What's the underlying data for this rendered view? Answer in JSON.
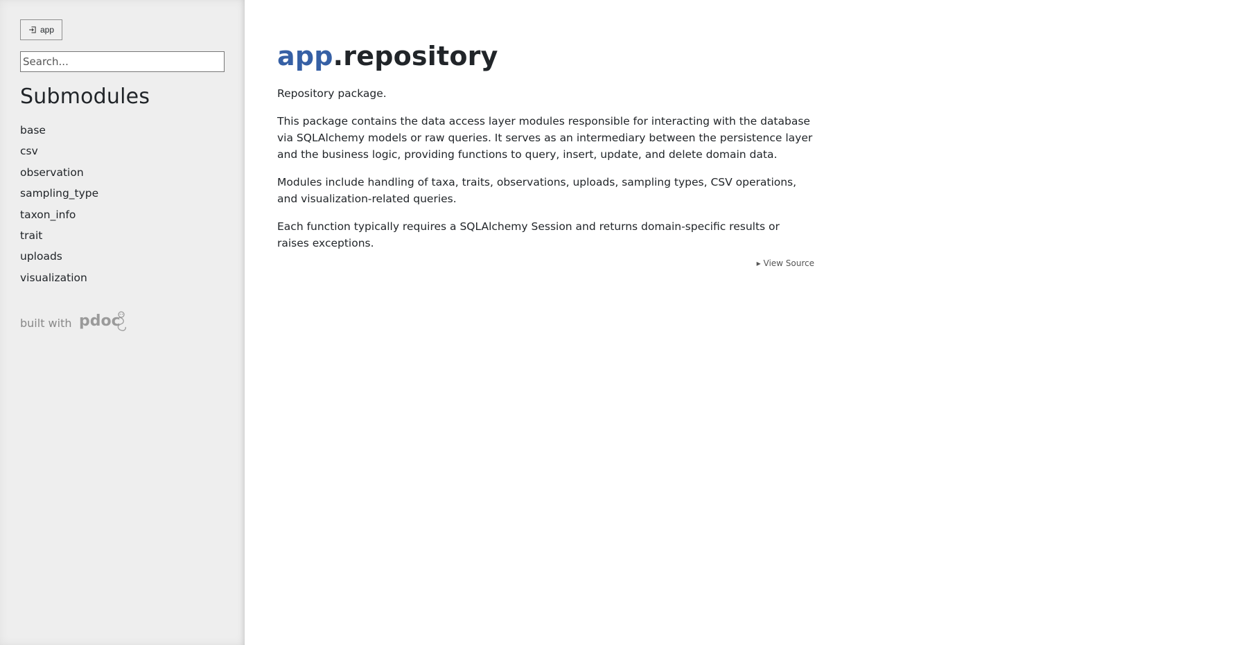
{
  "sidebar": {
    "home_button_label": "app",
    "search_placeholder": "Search...",
    "submodules_heading": "Submodules",
    "submodules": [
      {
        "label": "base"
      },
      {
        "label": "csv"
      },
      {
        "label": "observation"
      },
      {
        "label": "sampling_type"
      },
      {
        "label": "taxon_info"
      },
      {
        "label": "trait"
      },
      {
        "label": "uploads"
      },
      {
        "label": "visualization"
      }
    ],
    "attribution_text": "built with",
    "attribution_logo_text": "pdoc"
  },
  "main": {
    "title_package": "app",
    "title_module": ".repository",
    "docstring": [
      "Repository package.",
      "This package contains the data access layer modules responsible for interacting with the database via SQLAlchemy models or raw queries. It serves as an intermediary between the persistence layer and the business logic, providing functions to query, insert, update, and delete domain data.",
      "Modules include handling of taxa, traits, observations, uploads, sampling types, CSV operations, and visualization-related queries.",
      "Each function typically requires a SQLAlchemy Session and returns domain-specific results or raises exceptions."
    ],
    "view_source_label": "▸ View Source"
  },
  "colors": {
    "sidebar_bg": "#eeeeee",
    "title_package": "#3660a5",
    "text": "#212529",
    "muted": "#888888"
  },
  "icons": {
    "home_button": "box-arrow-in-left-icon",
    "attribution_logo": "pdoc-logo"
  }
}
